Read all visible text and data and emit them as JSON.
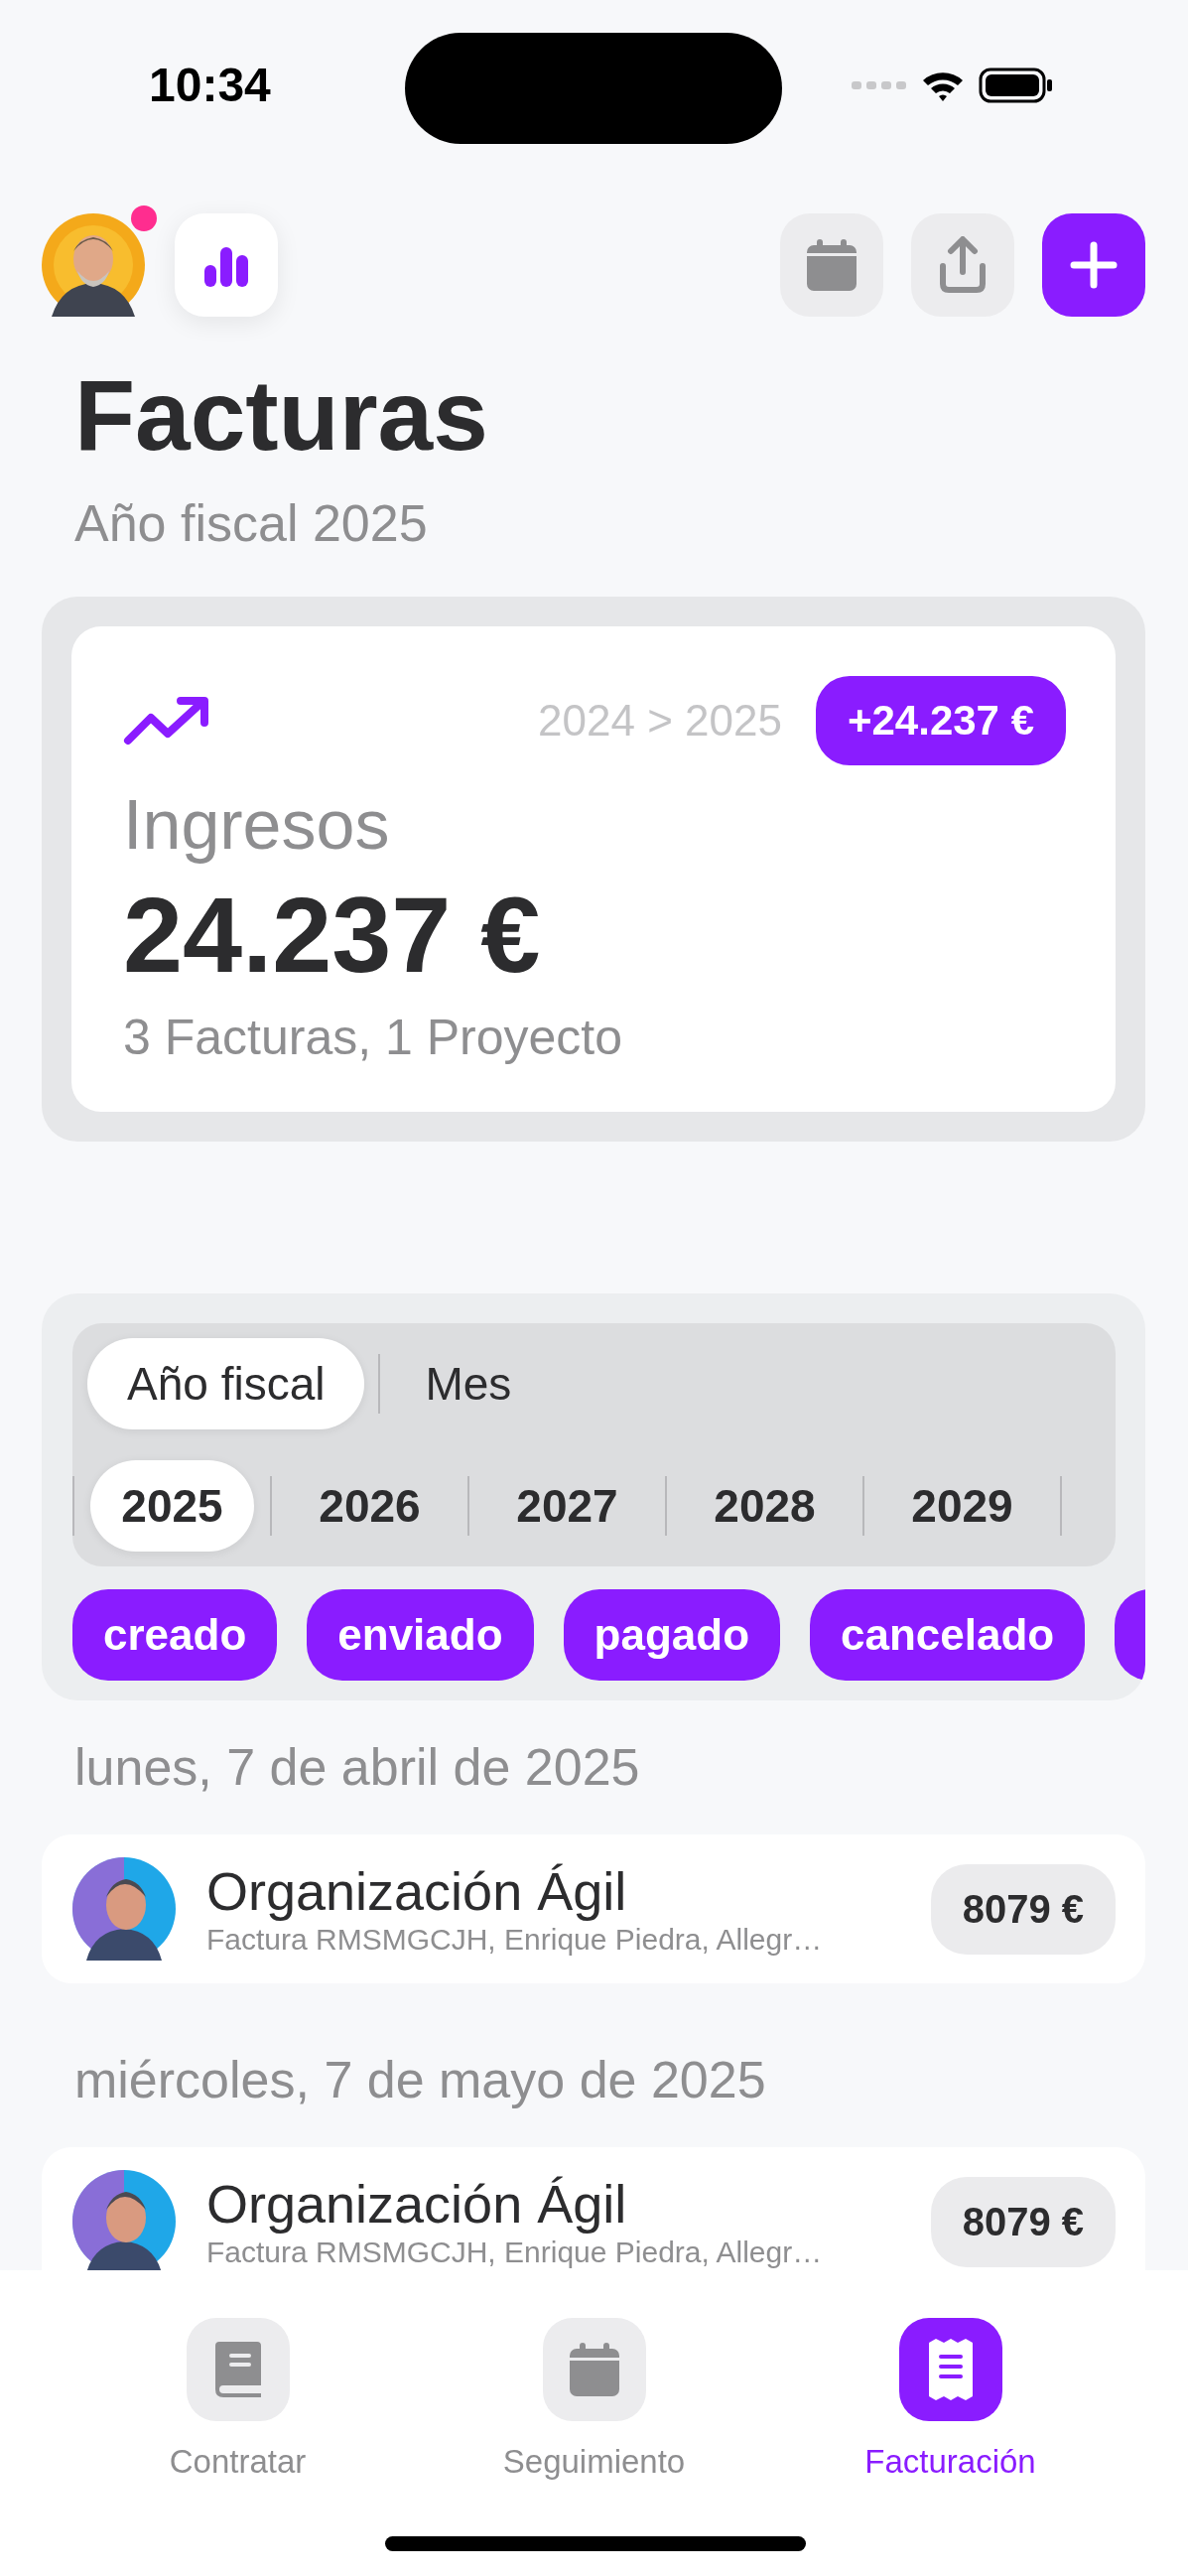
{
  "status_bar": {
    "time": "10:34"
  },
  "header": {
    "notification": true
  },
  "title": "Facturas",
  "subtitle": "Año fiscal 2025",
  "summary": {
    "comparison": "2024 > 2025",
    "change": "+24.237 €",
    "label": "Ingresos",
    "amount": "24.237 €",
    "detail": "3 Facturas, 1 Proyecto"
  },
  "period_tabs": [
    {
      "label": "Año fiscal",
      "selected": true
    },
    {
      "label": "Mes",
      "selected": false
    }
  ],
  "years": [
    {
      "label": "2025",
      "selected": true
    },
    {
      "label": "2026",
      "selected": false
    },
    {
      "label": "2027",
      "selected": false
    },
    {
      "label": "2028",
      "selected": false
    },
    {
      "label": "2029",
      "selected": false
    }
  ],
  "status_filters": [
    "creado",
    "enviado",
    "pagado",
    "cancelado"
  ],
  "groups": [
    {
      "date": "lunes, 7 de abril de 2025",
      "invoices": [
        {
          "client": "Organización Ágil",
          "detail": "Factura RMSMGCJH, Enrique Piedra, Allegr…",
          "amount": "8079 €"
        }
      ]
    },
    {
      "date": "miércoles, 7 de mayo de 2025",
      "invoices": [
        {
          "client": "Organización Ágil",
          "detail": "Factura RMSMGCJH, Enrique Piedra, Allegr…",
          "amount": "8079 €"
        }
      ]
    }
  ],
  "tab_bar": [
    {
      "label": "Contratar",
      "kind": "book",
      "selected": false
    },
    {
      "label": "Seguimiento",
      "kind": "calendar",
      "selected": false
    },
    {
      "label": "Facturación",
      "kind": "receipt",
      "selected": true
    }
  ]
}
